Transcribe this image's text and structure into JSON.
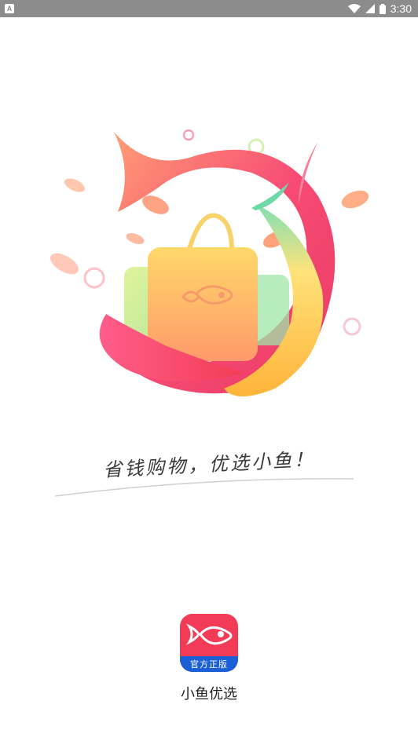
{
  "status_bar": {
    "notification_icon": "A",
    "time": "3:30",
    "icons": [
      "wifi-icon",
      "signal-icon",
      "battery-icon"
    ]
  },
  "splash": {
    "slogan": "省钱购物，优选小鱼！",
    "app_icon": {
      "badge": "官方正版",
      "brand_color": "#f23b56",
      "badge_color": "#1a5fd6"
    },
    "app_name": "小鱼优选"
  }
}
